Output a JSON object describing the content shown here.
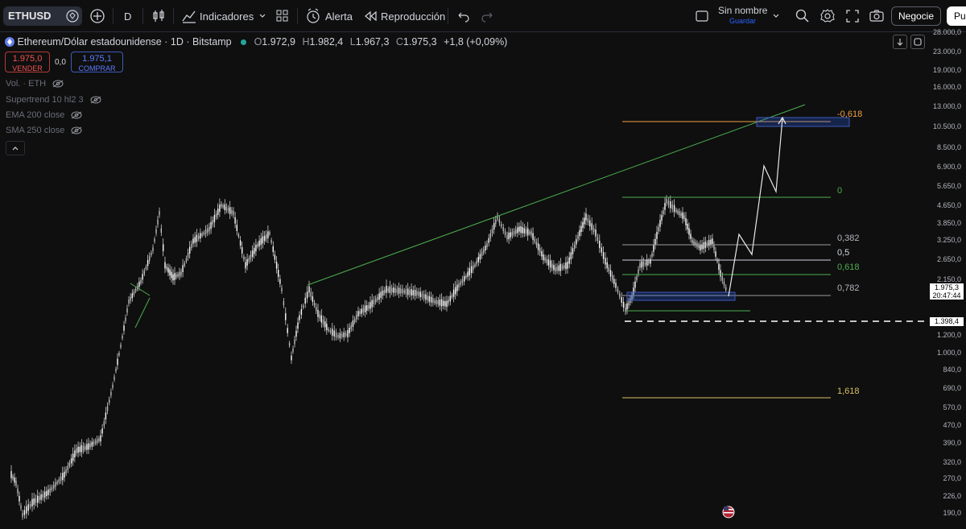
{
  "toolbar": {
    "symbol": "ETHUSD",
    "interval": "D",
    "indicators_label": "Indicadores",
    "alert_label": "Alerta",
    "replay_label": "Reproducción",
    "layout_name": "Sin nombre",
    "layout_save": "Guardar",
    "trade_label": "Negocie",
    "publish_label": "Pu"
  },
  "legend": {
    "title": "Ethereum/Dólar estadounidense · 1D · Bitstamp",
    "open_key": "O",
    "open": "1.972,9",
    "high_key": "H",
    "high": "1.982,4",
    "low_key": "L",
    "low": "1.967,3",
    "close_key": "C",
    "close": "1.975,3",
    "change": "+1,8 (+0,09%)"
  },
  "trade": {
    "sell_price": "1.975,0",
    "sell_label": "VENDER",
    "spread": "0,0",
    "buy_price": "1.975,1",
    "buy_label": "COMPRAR"
  },
  "indicators": [
    {
      "label": "Vol. · ETH"
    },
    {
      "label": "Supertrend 10 hl2 3"
    },
    {
      "label": "EMA 200 close"
    },
    {
      "label": "SMA 250 close"
    }
  ],
  "price_axis": [
    "28.000,0",
    "23.000,0",
    "19.000,0",
    "16.000,0",
    "13.000,0",
    "10.500,0",
    "8.500,0",
    "6.900,0",
    "5.650,0",
    "4.650,0",
    "3.850,0",
    "3.250,0",
    "2.650,0",
    "2.150,0",
    "1.200,0",
    "1.000,0",
    "840,0",
    "690,0",
    "570,0",
    "470,0",
    "390,0",
    "320,0",
    "270,0",
    "226,0",
    "190,0"
  ],
  "current_price": "1.975,3",
  "countdown": "20:47:44",
  "dashed_price": "1.398,4",
  "fib": {
    "l_neg618": "-0,618",
    "l0": "0",
    "l382": "0,382",
    "l5": "0,5",
    "l618": "0,618",
    "l782": "0,782",
    "l1618": "1,618"
  },
  "colors": {
    "background": "#0f0f0f",
    "candle": "#e8e8e8",
    "trendline": "#4caf50",
    "fib_neg618": "#f0a040",
    "fib_0": "#4caf50",
    "fib_mid": "#9e9e9e",
    "fib_1618": "#d4c060",
    "zone": "#3f5ab8"
  }
}
